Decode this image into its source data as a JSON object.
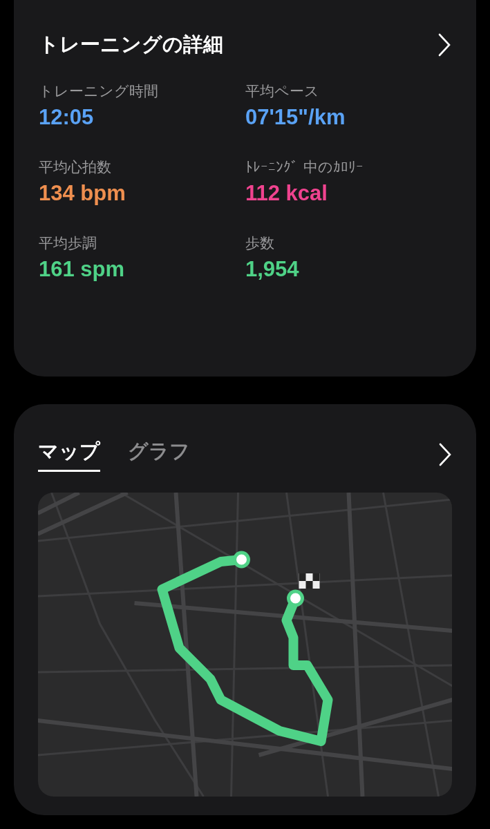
{
  "details": {
    "title": "トレーニングの詳細",
    "metrics": [
      {
        "label": "トレーニング時間",
        "value": "12:05",
        "color": "#5aa2f5"
      },
      {
        "label": "平均ペース",
        "value": "07'15\"/km",
        "color": "#5aa2f5"
      },
      {
        "label": "平均心拍数",
        "value": "134 bpm",
        "color": "#ef8f4f"
      },
      {
        "label": "ﾄﾚｰﾆﾝｸﾞ 中のｶﾛﾘｰ",
        "value": "112 kcal",
        "color": "#f0438f"
      },
      {
        "label": "平均歩調",
        "value": "161 spm",
        "color": "#4fd287"
      },
      {
        "label": "歩数",
        "value": "1,954",
        "color": "#4fd287"
      }
    ]
  },
  "route": {
    "tabs": [
      {
        "label": "マップ",
        "selected": true
      },
      {
        "label": "グラフ",
        "selected": false
      }
    ]
  }
}
